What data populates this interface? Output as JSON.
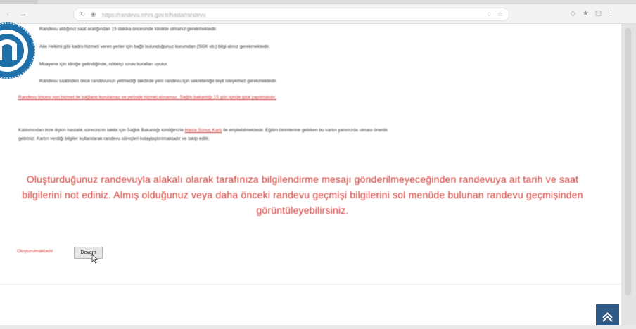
{
  "browser": {
    "back_icon": "back-arrow-icon",
    "forward_icon": "forward-arrow-icon",
    "url": "https://randevu.mhrs.gov.tr/hasta/randevu"
  },
  "page": {
    "paragraphs": [
      "Randevu aldığınız saat aralığından 15 dakika öncesinde klinikte olmanız gerekmektedir.",
      "Aile Hekimi gibi kadro hizmeti veren yerler için bağlı bulunduğunuz kurumdan (SGK vb.) bilgi alınız gerekmektedir.",
      "Muayene için kliniğe gelindiğinde, nöbetçi sınav kuralları uyulur.",
      "Randevu saatinden önce randevunun yetmediği takdirde yeni randevu için sekreterliğe teyit isteyemez gerekmektedir."
    ],
    "red_line": "Randevu öncesi son hizmet ile bağlantı kurulamaz ve yerinde hizmet alınamaz. Sağlık bakanlığı 15 gün içinde iptal yapılmalıdır.",
    "info_line1_before": "Katılımcıdan bize ilişkin hastalık sürecinizin takibi için Sağlık Bakanlığı kimliğinizle",
    "info_link": "Hasta Sonuç Kartı",
    "info_line1_after": "ile erişilebilmektedir. Eğitim birimlerine gelirken bu kartın yanınızda olması önerilir.",
    "info_line2": "getiriniz. Kartın verdiği bilgiler kullanılarak randevu süreçleri kolaylaştırılmaktadır ve takip edilir.",
    "notice": "Oluşturduğunuz randevuyla alakalı olarak tarafınıza bilgilendirme mesajı gönderilmeyeceğinden randevuya ait tarih ve saat bilgilerini not ediniz. Almış olduğunuz veya daha önceki randevu geçmişi bilgilerini sol menüde bulunan randevu geçmişinden görüntüleyebilirsiniz.",
    "return_label": "Oluşturulmaktadır",
    "return_button": "Devam"
  },
  "colors": {
    "notice_red": "#d33b35",
    "text_red": "#c8322f",
    "logo_blue": "#1f6fa8",
    "scroll_btn": "#2e5a87"
  }
}
